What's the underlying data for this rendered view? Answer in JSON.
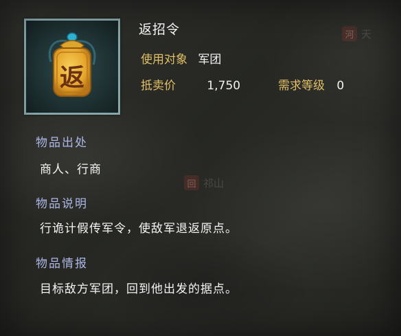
{
  "item": {
    "name": "返招令",
    "icon_glyph": "返",
    "icon": "golden-token-icon",
    "usage_label": "使用对象",
    "usage_value": "军团",
    "price_label": "抵卖价",
    "price_value": "1,750",
    "level_label": "需求等级",
    "level_value": "0"
  },
  "sections": [
    {
      "heading": "物品出处",
      "body": "商人、行商"
    },
    {
      "heading": "物品说明",
      "body": "行诡计假传军令，使敌军退返原点。"
    },
    {
      "heading": "物品情报",
      "body": "目标敌方军团，回到他出发的据点。"
    }
  ],
  "watermarks": {
    "top_right_badge": "河",
    "top_right_text": "天",
    "center_badge": "回",
    "center_text": "祁山"
  },
  "colors": {
    "label_gold": "#e0bf66",
    "heading_blue": "#aeb8e6",
    "frame_teal": "#86a6a8"
  }
}
